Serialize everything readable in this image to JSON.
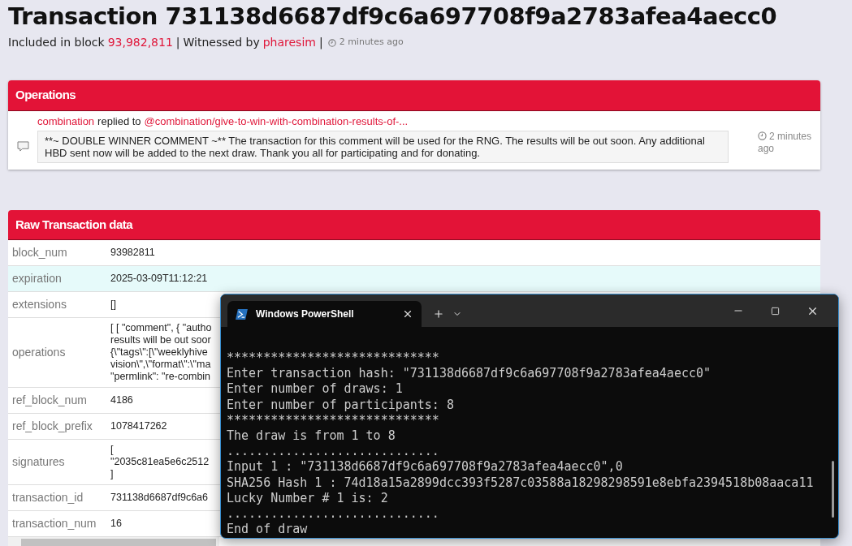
{
  "page": {
    "title": "Transaction 731138d6687df9c6a697708f9a2783afea4aecc0",
    "meta": {
      "included_label": "Included in block",
      "block": "93,982,811",
      "separator": "|",
      "witnessed_label": "Witnessed by",
      "witness": "pharesim",
      "time": "2 minutes ago"
    }
  },
  "operations": {
    "title": "Operations",
    "items": [
      {
        "author": "combination",
        "action": "replied to",
        "target": "@combination/give-to-win-with-combination-results-of-...",
        "body": "**~ DOUBLE WINNER COMMENT ~** The transaction for this comment will be used for the RNG. The results will be out soon. Any additional HBD sent now will be added to the next draw. Thank you all for participating and for donating.",
        "time": "2 minutes ago"
      }
    ]
  },
  "raw": {
    "title": "Raw Transaction data",
    "rows": [
      {
        "key": "block_num",
        "lines": [
          "93982811"
        ],
        "selected": false
      },
      {
        "key": "expiration",
        "lines": [
          "2025-03-09T11:12:21"
        ],
        "selected": true
      },
      {
        "key": "extensions",
        "lines": [
          "[]"
        ],
        "selected": false
      },
      {
        "key": "operations",
        "lines": [
          "[ [ \"comment\", { \"autho",
          "results will be out soor",
          "{\\\"tags\\\":[\\\"weeklyhive",
          "vision\\\",\\\"format\\\":\\\"ma",
          "\"permlink\": \"re-combin"
        ],
        "selected": false
      },
      {
        "key": "ref_block_num",
        "lines": [
          "4186"
        ],
        "selected": false
      },
      {
        "key": "ref_block_prefix",
        "lines": [
          "1078417262"
        ],
        "selected": false
      },
      {
        "key": "signatures",
        "lines": [
          "[",
          "\"2035c81ea5e6c2512",
          "]"
        ],
        "selected": false
      },
      {
        "key": "transaction_id",
        "lines": [
          "731138d6687df9c6a6"
        ],
        "selected": false
      },
      {
        "key": "transaction_num",
        "lines": [
          "16"
        ],
        "selected": false
      }
    ]
  },
  "terminal": {
    "tab_title": "Windows PowerShell",
    "lines": [
      "*****************************",
      "Enter transaction hash: \"731138d6687df9c6a697708f9a2783afea4aecc0\"",
      "Enter number of draws: 1",
      "Enter number of participants: 8",
      "*****************************",
      "The draw is from 1 to 8",
      ".............................",
      "Input 1 : \"731138d6687df9c6a697708f9a2783afea4aecc0\",0",
      "SHA256 Hash 1 : 74d18a15a2899dcc393f5287c03588a18298298591e8ebfa2394518b08aaca11",
      "Lucky Number # 1 is: 2",
      ".............................",
      "End of draw"
    ]
  }
}
